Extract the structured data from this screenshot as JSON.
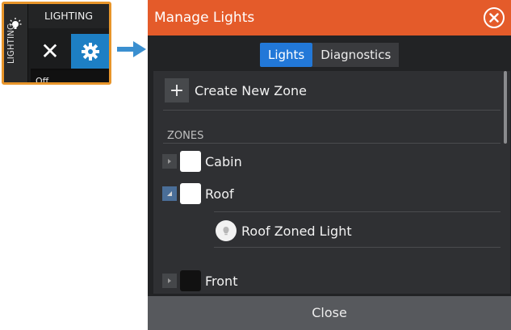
{
  "widget": {
    "title": "LIGHTING",
    "vertical_label": "LIGHTING",
    "state_label": "Off",
    "icons": {
      "bulb": "bulb-icon",
      "close": "close-icon",
      "settings": "gear-icon"
    },
    "colors": {
      "border": "#e8952a",
      "active": "#1d7fc4"
    }
  },
  "arrow": {
    "icon": "arrow-right-icon",
    "color": "#3a8fd0"
  },
  "dialog": {
    "title": "Manage Lights",
    "title_color": "#e45b2a",
    "tabs": [
      {
        "label": "Lights",
        "active": true
      },
      {
        "label": "Diagnostics",
        "active": false
      }
    ],
    "create_zone_label": "Create New Zone",
    "zones_header": "ZONES",
    "zones": [
      {
        "label": "Cabin",
        "expanded": false,
        "color": "#ffffff"
      },
      {
        "label": "Roof",
        "expanded": true,
        "color": "#ffffff",
        "lights": [
          {
            "label": "Roof Zoned Light",
            "icon": "light-icon"
          }
        ]
      },
      {
        "label": "Front",
        "expanded": false,
        "color": "#111111"
      }
    ],
    "close_label": "Close"
  }
}
